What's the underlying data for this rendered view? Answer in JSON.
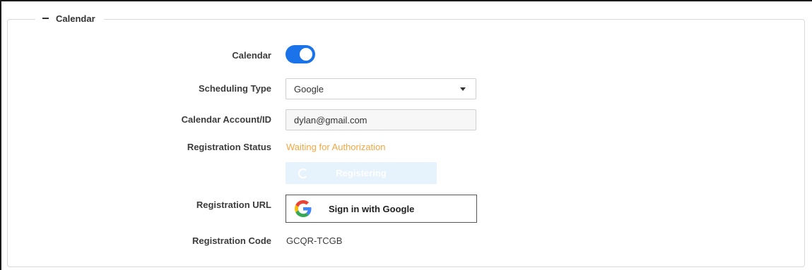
{
  "section": {
    "title": "Calendar",
    "collapse_icon": "minus-icon"
  },
  "fields": {
    "calendar": {
      "label": "Calendar",
      "enabled": true
    },
    "scheduling_type": {
      "label": "Scheduling Type",
      "value": "Google"
    },
    "account": {
      "label": "Calendar Account/ID",
      "value": "dylan@gmail.com"
    },
    "registration_status": {
      "label": "Registration Status",
      "value": "Waiting for Authorization"
    },
    "register_button": {
      "label": "Registering"
    },
    "registration_url": {
      "label": "Registration URL",
      "button_label": "Sign in with Google",
      "icon": "google-icon"
    },
    "registration_code": {
      "label": "Registration Code",
      "value": "GCQR-TCGB"
    }
  },
  "colors": {
    "toggle_on": "#1a73e8",
    "status_warning": "#f5a742",
    "register_button_bg": "#e6f2fc"
  }
}
